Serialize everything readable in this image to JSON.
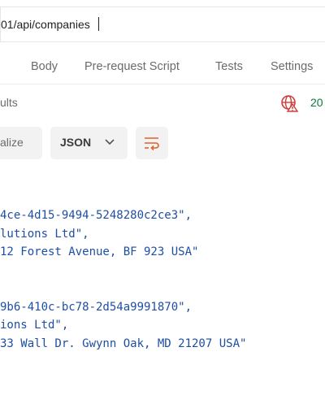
{
  "url_bar": {
    "value": "01/api/companies"
  },
  "tabs": [
    {
      "label": ")"
    },
    {
      "label": "Body"
    },
    {
      "label": "Pre-request Script"
    },
    {
      "label": "Tests"
    },
    {
      "label": "Settings"
    }
  ],
  "response": {
    "label": "ults",
    "status_code": "20",
    "status_color": "#0b7a3b",
    "error_icon_color": "#d23c3c"
  },
  "toolbar": {
    "visualize_label": "alize",
    "format_label": "JSON",
    "format_icon": "chevron-down-icon",
    "wrap_icon": "wrap-lines-icon"
  },
  "body_lines": [
    "4ce-4d15-9494-5248280c2ce3\",",
    "lutions Ltd\",",
    "12 Forest Avenue, BF 923 USA\"",
    "9b6-410c-bc78-2d54a9991870\",",
    "ions Ltd\",",
    "33 Wall Dr. Gwynn Oak, MD 21207 USA\""
  ]
}
